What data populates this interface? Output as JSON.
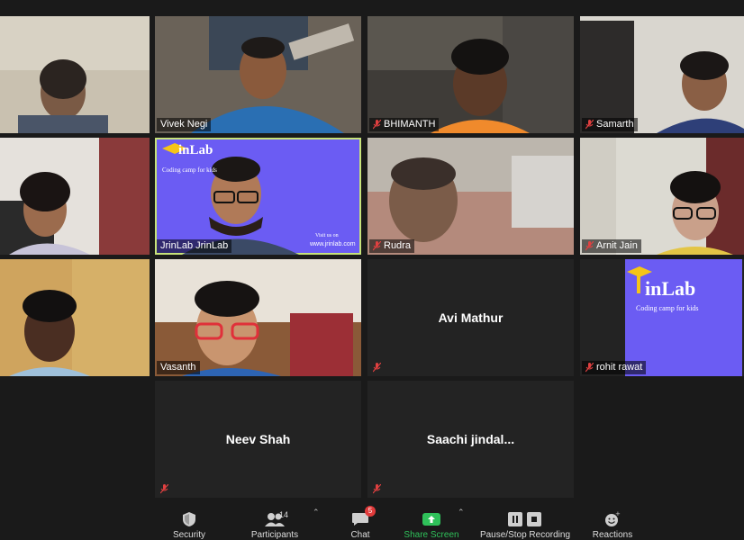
{
  "participants": [
    {
      "name": "",
      "muted": false
    },
    {
      "name": "Vivek Negi",
      "muted": false
    },
    {
      "name": "BHIMANTH",
      "muted": true
    },
    {
      "name": "Samarth",
      "muted": true
    },
    {
      "name": "",
      "muted": false
    },
    {
      "name": "JrinLab JrinLab",
      "muted": false
    },
    {
      "name": "Rudra",
      "muted": true
    },
    {
      "name": "Arnit Jain",
      "muted": true
    },
    {
      "name": "",
      "muted": false
    },
    {
      "name": "Vasanth",
      "muted": false
    },
    {
      "name": "Avi Mathur",
      "muted": true
    },
    {
      "name": "rohit rawat",
      "muted": true
    },
    {
      "name": "Neev Shah",
      "muted": true
    },
    {
      "name": "Saachi  jindal...",
      "muted": true
    }
  ],
  "branding": {
    "logo_text": "inLab",
    "tagline": "Coding camp for kids",
    "visit": "Visit us on",
    "url": "www.jrinlab.com"
  },
  "toolbar": {
    "security": "Security",
    "participants": "Participants",
    "participants_count": "14",
    "chat": "Chat",
    "chat_badge": "5",
    "share": "Share Screen",
    "recording": "Pause/Stop Recording",
    "reactions": "Reactions"
  },
  "colors": {
    "active_speaker": "#c7e27a",
    "share_green": "#2fc15a",
    "brand_purple": "#6b5cf3",
    "mute_red": "#e04040"
  }
}
